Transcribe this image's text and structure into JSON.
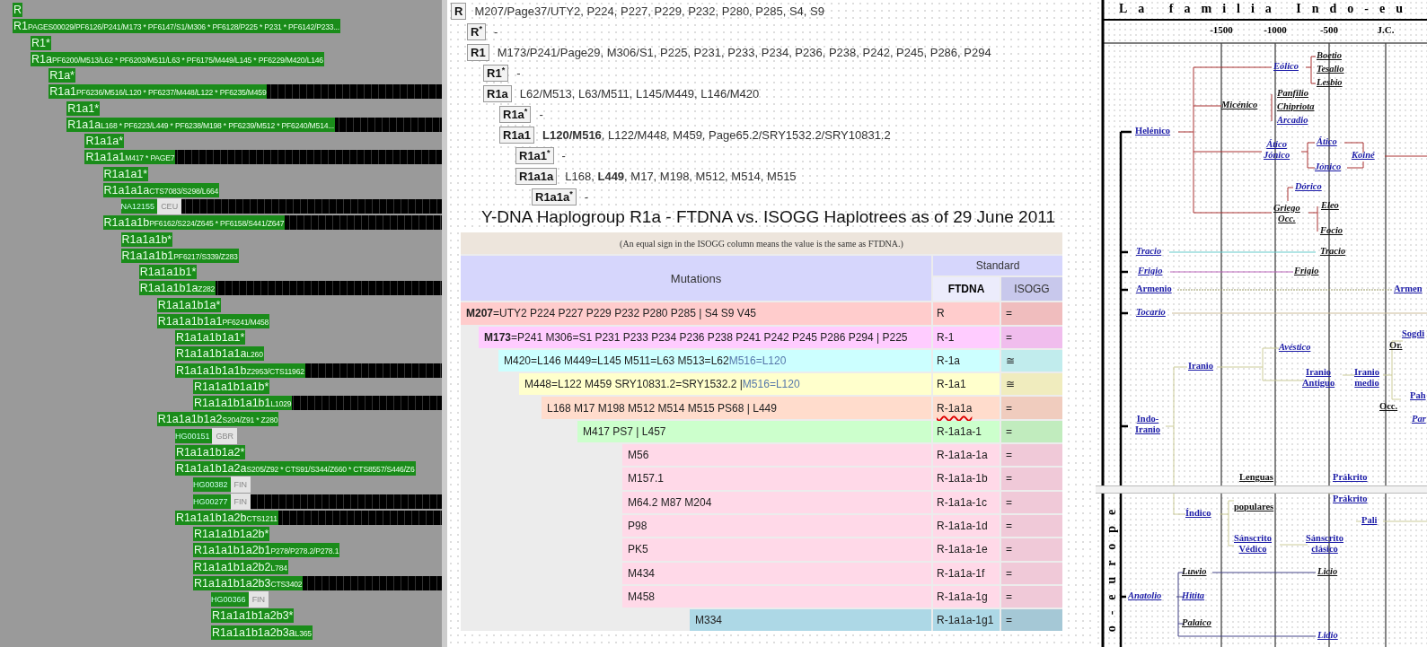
{
  "haplotree": {
    "items": [
      {
        "kind": "clade",
        "code": "R",
        "highlighted": false
      },
      {
        "kind": "clade",
        "code": "R1",
        "snps": "PAGES00029/PF6126/P241/M173 * PF6147/S1/M306 * PF6128/P225 * P231 * PF6142/P233...",
        "highlighted": false,
        "children": [
          {
            "kind": "clade",
            "code": "R1*",
            "highlighted": false
          },
          {
            "kind": "clade",
            "code": "R1a",
            "snps": "PF6200/M513/L62 * PF6203/M511/L63 * PF6175/M449/L145 * PF6229/M420/L146",
            "highlighted": false,
            "children": [
              {
                "kind": "clade",
                "code": "R1a*",
                "highlighted": false
              },
              {
                "kind": "clade",
                "code": "R1a1",
                "snps": "PF6236/M516/L120 * PF6237/M448/L122 * PF6235/M459",
                "highlighted": true,
                "children": [
                  {
                    "kind": "clade",
                    "code": "R1a1*",
                    "highlighted": false
                  },
                  {
                    "kind": "clade",
                    "code": "R1a1a",
                    "snps": "L168 * PF6223/L449 * PF6238/M198 * PF6239/M512 * PF6240/M514...",
                    "highlighted": true,
                    "children": [
                      {
                        "kind": "clade",
                        "code": "R1a1a*",
                        "highlighted": false
                      },
                      {
                        "kind": "clade",
                        "code": "R1a1a1",
                        "snps": "M417 * PAGE7",
                        "highlighted": true,
                        "children": [
                          {
                            "kind": "clade",
                            "code": "R1a1a1*",
                            "highlighted": false
                          },
                          {
                            "kind": "clade",
                            "code": "R1a1a1a",
                            "snps": "CTS7083/S298/L664",
                            "highlighted": false,
                            "children": [
                              {
                                "kind": "sample",
                                "id": "NA12155",
                                "population": "CEU",
                                "highlighted": true
                              }
                            ]
                          },
                          {
                            "kind": "clade",
                            "code": "R1a1a1b",
                            "snps": "PF6162/S224/Z645 * PF6158/S441/Z647",
                            "highlighted": true,
                            "children": [
                              {
                                "kind": "clade",
                                "code": "R1a1a1b*",
                                "highlighted": false
                              },
                              {
                                "kind": "clade",
                                "code": "R1a1a1b1",
                                "snps": "PF6217/S339/Z283",
                                "highlighted": false,
                                "children": [
                                  {
                                    "kind": "clade",
                                    "code": "R1a1a1b1*",
                                    "highlighted": false
                                  },
                                  {
                                    "kind": "clade",
                                    "code": "R1a1a1b1a",
                                    "snps": "Z282",
                                    "highlighted": true,
                                    "children": [
                                      {
                                        "kind": "clade",
                                        "code": "R1a1a1b1a*",
                                        "highlighted": false
                                      },
                                      {
                                        "kind": "clade",
                                        "code": "R1a1a1b1a1",
                                        "snps": "PF6241/M458",
                                        "highlighted": false,
                                        "children": [
                                          {
                                            "kind": "clade",
                                            "code": "R1a1a1b1a1*",
                                            "highlighted": false
                                          },
                                          {
                                            "kind": "clade",
                                            "code": "R1a1a1b1a1a",
                                            "snps": "L260",
                                            "highlighted": false
                                          },
                                          {
                                            "kind": "clade",
                                            "code": "R1a1a1b1a1b",
                                            "snps": "Z2953/CTS11962",
                                            "highlighted": true,
                                            "children": [
                                              {
                                                "kind": "clade",
                                                "code": "R1a1a1b1a1b*",
                                                "highlighted": false
                                              },
                                              {
                                                "kind": "clade",
                                                "code": "R1a1a1b1a1b1",
                                                "snps": "L1029",
                                                "highlighted": true
                                              }
                                            ]
                                          }
                                        ]
                                      },
                                      {
                                        "kind": "clade",
                                        "code": "R1a1a1b1a2",
                                        "snps": "S204/Z91 * Z280",
                                        "highlighted": false,
                                        "children": [
                                          {
                                            "kind": "sample",
                                            "id": "HG00151",
                                            "population": "GBR",
                                            "highlighted": false
                                          },
                                          {
                                            "kind": "clade",
                                            "code": "R1a1a1b1a2*",
                                            "highlighted": false
                                          },
                                          {
                                            "kind": "clade",
                                            "code": "R1a1a1b1a2a",
                                            "snps": "S205/Z92 * CTS91/S344/Z660 * CTS8557/S446/Z6",
                                            "highlighted": false,
                                            "children": [
                                              {
                                                "kind": "sample",
                                                "id": "HG00382",
                                                "population": "FIN",
                                                "highlighted": false
                                              },
                                              {
                                                "kind": "sample",
                                                "id": "HG00277",
                                                "population": "FIN",
                                                "highlighted": true
                                              }
                                            ]
                                          },
                                          {
                                            "kind": "clade",
                                            "code": "R1a1a1b1a2b",
                                            "snps": "CTS1211",
                                            "highlighted": true,
                                            "children": [
                                              {
                                                "kind": "clade",
                                                "code": "R1a1a1b1a2b*",
                                                "highlighted": false
                                              },
                                              {
                                                "kind": "clade",
                                                "code": "R1a1a1b1a2b1",
                                                "snps": "P278/P278.2/P278.1",
                                                "highlighted": false
                                              },
                                              {
                                                "kind": "clade",
                                                "code": "R1a1a1b1a2b2",
                                                "snps": "L784",
                                                "highlighted": false
                                              },
                                              {
                                                "kind": "clade",
                                                "code": "R1a1a1b1a2b3",
                                                "snps": "CTS3402",
                                                "highlighted": true,
                                                "children": [
                                                  {
                                                    "kind": "sample",
                                                    "id": "HG00366",
                                                    "population": "FIN",
                                                    "highlighted": false
                                                  },
                                                  {
                                                    "kind": "clade",
                                                    "code": "R1a1a1b1a2b3*",
                                                    "highlighted": false
                                                  },
                                                  {
                                                    "kind": "clade",
                                                    "code": "R1a1a1b1a2b3a",
                                                    "snps": "L365",
                                                    "highlighted": false
                                                  }
                                                ]
                                              }
                                            ]
                                          }
                                        ]
                                      }
                                    ]
                                  }
                                ]
                              }
                            ]
                          }
                        ]
                      }
                    ]
                  }
                ]
              }
            ]
          }
        ]
      }
    ]
  },
  "outline": {
    "items": [
      {
        "code": "R",
        "markers": "M207/Page37/UTY2, P224, P227, P229, P232, P280, P285, S4, S9",
        "children": [
          {
            "code": "R$^{*}$",
            "markers": "-"
          },
          {
            "code": "R1",
            "markers": "M173/P241/Page29, M306/S1, P225, P231, P233, P234, P236, P238, P242, P245, P286, P294",
            "children": [
              {
                "code": "R1$^{*}$",
                "markers": "-"
              },
              {
                "code": "R1a",
                "markers": "L62/M513, L63/M511, L145/M449, L146/M420",
                "children": [
                  {
                    "code": "R1a$^{*}$",
                    "markers": "-"
                  },
                  {
                    "code": "R1a1",
                    "markers": "**L120/M516**, L122/M448, M459, Page65.2/SRY1532.2/SRY10831.2",
                    "children": [
                      {
                        "code": "R1a1$^{*}$",
                        "markers": "-"
                      },
                      {
                        "code": "R1a1a",
                        "markers": "L168, **L449**, M17, M198, M512, M514, M515",
                        "children": [
                          {
                            "code": "R1a1a$^{*}$",
                            "markers": "-"
                          }
                        ]
                      }
                    ]
                  }
                ]
              }
            ]
          }
        ]
      }
    ]
  },
  "figure": {
    "title": "Y-DNA Haplogroup R1a - FTDNA vs. ISOGG Haplotrees as of 29 June 2011",
    "note": "(An equal sign in the ISOGG column means the value is the same as FTDNA.)",
    "columns": {
      "mutations": "Mutations",
      "standard": "Standard",
      "ftdna": "FTDNA",
      "isogg": "ISOGG"
    },
    "rows": [
      {
        "mutations": "**M207**=UTY2 P224 P227 P229 P232 P280 P285 | S4 S9 V45",
        "ftdna": "R",
        "isogg": "=",
        "color": "#ffcccc",
        "marked": false,
        "children": [
          {
            "mutations": "**M173**=P241 M306=S1 P231 P233 P234 P236 P238 P241 P242 P245 P286 P294 | P225",
            "ftdna": "R-1",
            "isogg": "=",
            "color": "#ffccff",
            "marked": false,
            "children": [
              {
                "mutations": "M420=L146 M449=L145 M511=L63 M513=L62",
                "extra": "M516=L120",
                "ftdna": "R-1a",
                "isogg": "≅",
                "color": "#ccffff",
                "marked": false,
                "children": [
                  {
                    "mutations": "M448=L122 M459 SRY10831.2=SRY1532.2 |",
                    "extra": "M516=L120",
                    "ftdna": "R-1a1",
                    "isogg": "≅",
                    "color": "#ffffcc",
                    "marked": false,
                    "children": [
                      {
                        "mutations": "L168 M17 M198 M512 M514 M515 PS68 | L449",
                        "ftdna": "R-1a1a",
                        "isogg": "=",
                        "color": "#ffdccc",
                        "marked": true,
                        "children": [
                          {
                            "mutations": "M417 PS7 | L457",
                            "ftdna": "R-1a1a-1",
                            "isogg": "=",
                            "color": "#ccffcc",
                            "marked": false,
                            "children": [
                              {
                                "mutations": "M56",
                                "ftdna": "R-1a1a-1a",
                                "isogg": "=",
                                "color": "#ffd9e8",
                                "marked": false
                              },
                              {
                                "mutations": "M157.1",
                                "ftdna": "R-1a1a-1b",
                                "isogg": "=",
                                "color": "#ffd9e8",
                                "marked": false
                              },
                              {
                                "mutations": "M64.2 M87 M204",
                                "ftdna": "R-1a1a-1c",
                                "isogg": "=",
                                "color": "#ffd9e8",
                                "marked": false
                              },
                              {
                                "mutations": "P98",
                                "ftdna": "R-1a1a-1d",
                                "isogg": "=",
                                "color": "#ffd9e8",
                                "marked": false
                              },
                              {
                                "mutations": "PK5",
                                "ftdna": "R-1a1a-1e",
                                "isogg": "=",
                                "color": "#ffd9e8",
                                "marked": false
                              },
                              {
                                "mutations": "M434",
                                "ftdna": "R-1a1a-1f",
                                "isogg": "=",
                                "color": "#ffd9e8",
                                "marked": false
                              },
                              {
                                "mutations": "M458",
                                "ftdna": "R-1a1a-1g",
                                "isogg": "=",
                                "color": "#ffd9e8",
                                "marked": false,
                                "children": [
                                  {
                                    "mutations": "M334",
                                    "ftdna": "R-1a1a-1g1",
                                    "isogg": "=",
                                    "color": "#add8e6",
                                    "marked": false
                                  }
                                ]
                              }
                            ]
                          }
                        ]
                      }
                    ]
                  }
                ]
              }
            ]
          }
        ]
      }
    ]
  },
  "timeline": {
    "title": "La familia Indo-eu",
    "ticks": [
      "-1500",
      "-1000",
      "-500",
      "J.C."
    ],
    "side_label": "o-europe",
    "nodes": [
      {
        "text": "Eólico",
        "kind": "link-italic"
      },
      {
        "text": "Boetio",
        "kind": "plain-italic"
      },
      {
        "text": "Tesalio",
        "kind": "plain-italic"
      },
      {
        "text": "Lesbio",
        "kind": "plain-italic"
      },
      {
        "text": "Micénico",
        "kind": "plain-italic"
      },
      {
        "text": "Panfilio",
        "kind": "plain-italic"
      },
      {
        "text": "Chipriota",
        "kind": "plain-italic"
      },
      {
        "text": "Arcadio",
        "kind": "link-italic"
      },
      {
        "text": "Helénico",
        "kind": "link"
      },
      {
        "text": "Ático\nJónico",
        "kind": "link-italic"
      },
      {
        "text": "Ático",
        "kind": "link-italic"
      },
      {
        "text": "Jónico",
        "kind": "link-italic"
      },
      {
        "text": "Koiné",
        "kind": "link-italic"
      },
      {
        "text": "Dórico",
        "kind": "link-italic"
      },
      {
        "text": "Griego\nOcc.",
        "kind": "plain-italic"
      },
      {
        "text": "Eleo",
        "kind": "plain-italic"
      },
      {
        "text": "Focio",
        "kind": "plain-italic"
      },
      {
        "text": "Tracio",
        "kind": "link-italic"
      },
      {
        "text": "Tracio",
        "kind": "plain-italic"
      },
      {
        "text": "Frigio",
        "kind": "link-italic"
      },
      {
        "text": "Frigio",
        "kind": "plain-italic"
      },
      {
        "text": "Armenio",
        "kind": "link"
      },
      {
        "text": "Armen",
        "kind": "link"
      },
      {
        "text": "Tocario",
        "kind": "link-italic"
      },
      {
        "text": "Sogdi",
        "kind": "link"
      },
      {
        "text": "Or.",
        "kind": "plain"
      },
      {
        "text": "Avéstico",
        "kind": "link-italic"
      },
      {
        "text": "Iranio",
        "kind": "link"
      },
      {
        "text": "Iranio\nAntiguo",
        "kind": "link"
      },
      {
        "text": "Iranio\nmedio",
        "kind": "link"
      },
      {
        "text": "Occ.",
        "kind": "plain"
      },
      {
        "text": "Pah",
        "kind": "link"
      },
      {
        "text": "Par",
        "kind": "link-italic"
      },
      {
        "text": "Indo-\nIranio",
        "kind": "link"
      },
      {
        "text": "Lenguas",
        "kind": "plain"
      },
      {
        "text": "Prákrito",
        "kind": "link"
      },
      {
        "text": "populares",
        "kind": "plain"
      },
      {
        "text": "Prákrito",
        "kind": "link"
      },
      {
        "text": "Índico",
        "kind": "link"
      },
      {
        "text": "Pali",
        "kind": "link"
      },
      {
        "text": "Sánscrito\nVédico",
        "kind": "link"
      },
      {
        "text": "Sánscrito\nclásico",
        "kind": "link"
      },
      {
        "text": "Luwio",
        "kind": "plain-italic"
      },
      {
        "text": "Licio",
        "kind": "plain-italic"
      },
      {
        "text": "Anatolio",
        "kind": "link-italic"
      },
      {
        "text": "Hitita",
        "kind": "link-italic"
      },
      {
        "text": "Palaico",
        "kind": "plain-italic"
      },
      {
        "text": "Lidio",
        "kind": "link-italic"
      }
    ]
  }
}
